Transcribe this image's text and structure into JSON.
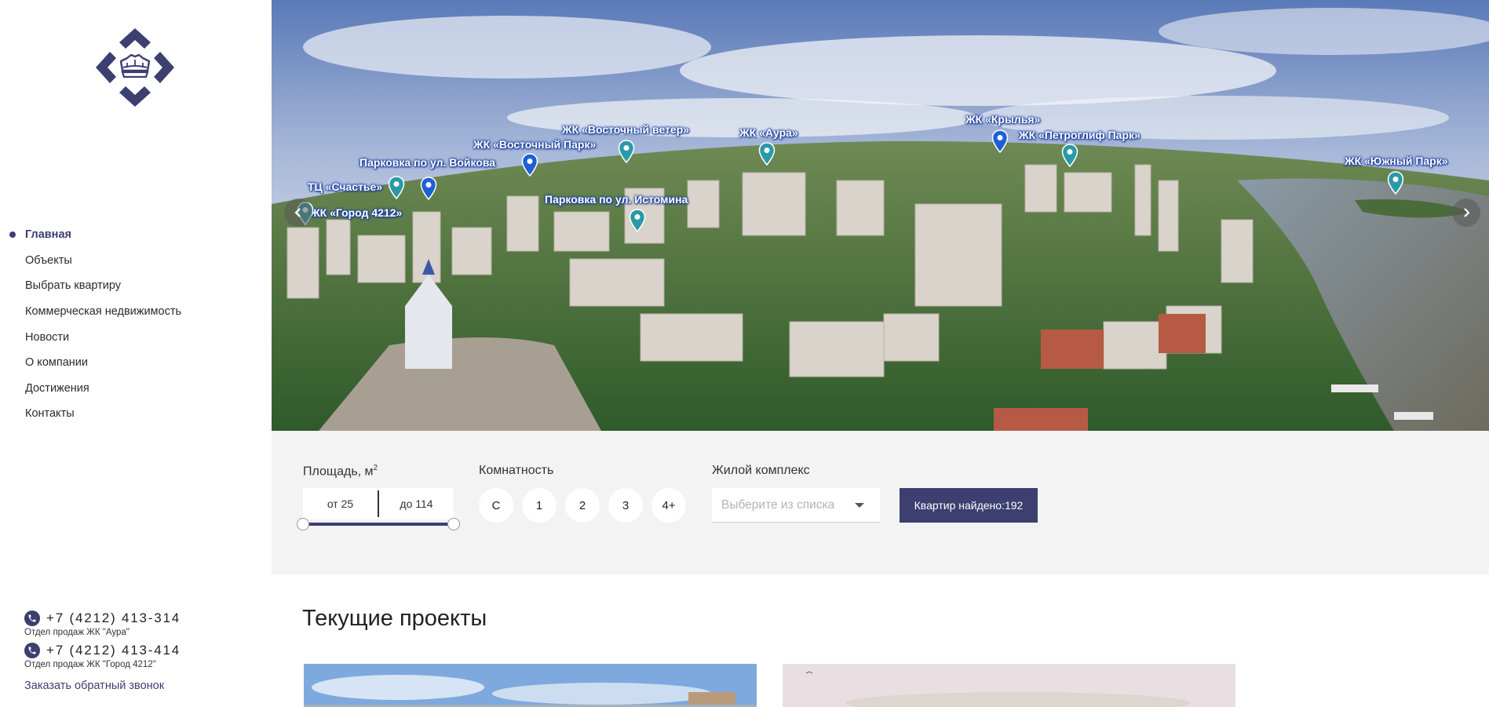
{
  "sidebar": {
    "logo_icon": "crown-diamond-logo",
    "nav": [
      {
        "label": "Главная",
        "active": true
      },
      {
        "label": "Объекты",
        "active": false
      },
      {
        "label": "Выбрать квартиру",
        "active": false
      },
      {
        "label": "Коммерческая недвижимость",
        "active": false
      },
      {
        "label": "Новости",
        "active": false
      },
      {
        "label": "О компании",
        "active": false
      },
      {
        "label": "Достижения",
        "active": false
      },
      {
        "label": "Контакты",
        "active": false
      }
    ],
    "contacts": [
      {
        "phone": "+7 (4212) 413-314",
        "caption": "Отдел продаж ЖК \"Аура\""
      },
      {
        "phone": "+7 (4212) 413-414",
        "caption": "Отдел продаж ЖК \"Город 4212\""
      }
    ],
    "callback_label": "Заказать обратный звонок"
  },
  "hero": {
    "pins": [
      {
        "label": "ЖК «Город 4212»",
        "color": "teal"
      },
      {
        "label": "ТЦ «Счастье»",
        "color": "teal"
      },
      {
        "label": "Парковка по ул. Войкова",
        "color": "blue"
      },
      {
        "label": "ЖК «Восточный Парк»",
        "color": "blue"
      },
      {
        "label": "ЖК «Восточный ветер»",
        "color": "teal"
      },
      {
        "label": "Парковка по ул. Истомина",
        "color": "teal"
      },
      {
        "label": "ЖК «Аура»",
        "color": "teal"
      },
      {
        "label": "ЖК «Крылья»",
        "color": "blue"
      },
      {
        "label": "ЖК «Петроглиф Парк»",
        "color": "teal"
      },
      {
        "label": "ЖК «Южный Парк»",
        "color": "teal"
      }
    ],
    "prev_icon": "chevron-left-icon",
    "next_icon": "chevron-right-icon"
  },
  "filter": {
    "area_label": "Площадь, м",
    "area_unit_sup": "2",
    "area_from": "от 25",
    "area_to": "до 114",
    "area_range_fraction": [
      0.0,
      1.0
    ],
    "rooms_label": "Комнатность",
    "rooms": [
      "С",
      "1",
      "2",
      "3",
      "4+"
    ],
    "complex_label": "Жилой комплекс",
    "complex_placeholder": "Выберите из списка",
    "found_button": "Квартир найдено:192"
  },
  "projects": {
    "title": "Текущие проекты"
  },
  "colors": {
    "brand": "#3c3f70",
    "pin_teal": "#2a9aa8",
    "pin_blue": "#1f5fd6",
    "filter_bg": "#f3f3f3"
  }
}
